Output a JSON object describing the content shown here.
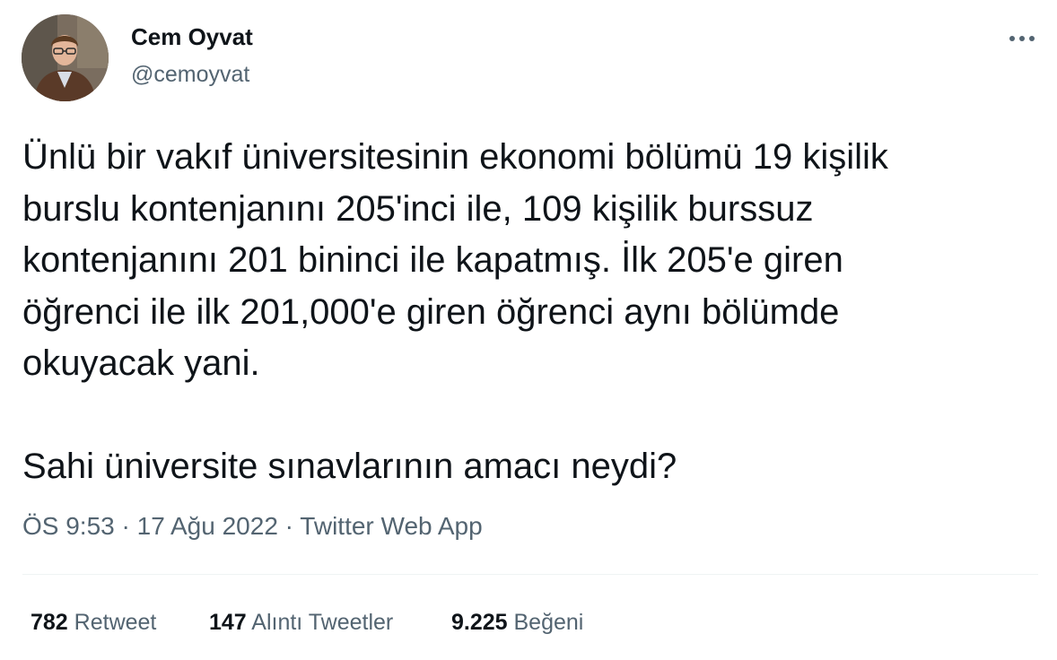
{
  "author": {
    "display_name": "Cem Oyvat",
    "handle": "@cemoyvat",
    "avatar_icon": "profile-photo"
  },
  "menu": {
    "icon": "more-dots-icon"
  },
  "tweet": {
    "paragraph1_lines": [
      "Ünlü bir vakıf üniversitesinin ekonomi bölümü 19 kişilik",
      "burslu kontenjanını 205'inci ile, 109 kişilik burssuz",
      "kontenjanını 201 bininci ile kapatmış. İlk 205'e giren",
      "öğrenci ile ilk 201,000'e giren öğrenci aynı bölümde",
      "okuyacak yani."
    ],
    "paragraph2": "Sahi üniversite sınavlarının amacı neydi?"
  },
  "meta": {
    "time": "ÖS 9:53",
    "separator": " · ",
    "date": "17 Ağu 2022",
    "source": "Twitter Web App"
  },
  "stats": {
    "retweets_count": "782",
    "retweets_label": " Retweet",
    "quotes_count": "147",
    "quotes_label": " Alıntı Tweetler",
    "likes_count": "9.225",
    "likes_label": " Beğeni"
  },
  "colors": {
    "text_primary": "#0f1419",
    "text_secondary": "#536471",
    "divider": "#eff3f4"
  }
}
